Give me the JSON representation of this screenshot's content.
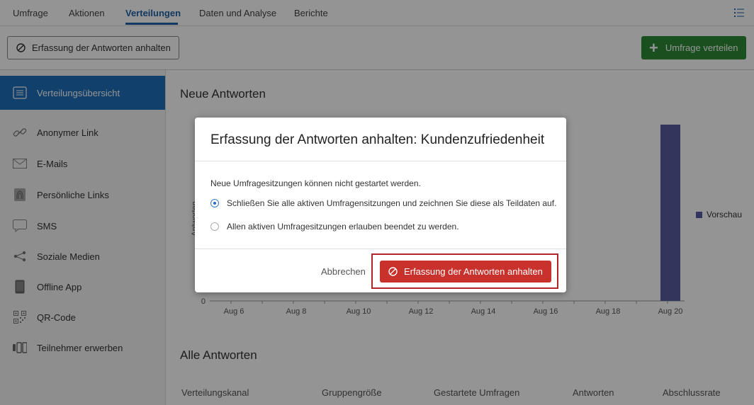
{
  "nav": {
    "tabs": [
      {
        "label": "Umfrage"
      },
      {
        "label": "Aktionen"
      },
      {
        "label": "Verteilungen"
      },
      {
        "label": "Daten und Analyse"
      },
      {
        "label": "Berichte"
      }
    ],
    "active_tab": "Verteilungen",
    "menu_icon": "list-menu-icon"
  },
  "toolbar": {
    "pause_label": "Erfassung der Antworten anhalten",
    "distribute_label": "Umfrage verteilen"
  },
  "sidebar": {
    "items": [
      {
        "label": "Verteilungsübersicht",
        "icon": "overview-icon"
      },
      {
        "label": "Anonymer Link",
        "icon": "link-icon"
      },
      {
        "label": "E-Mails",
        "icon": "envelope-icon"
      },
      {
        "label": "Persönliche Links",
        "icon": "fingerprint-icon"
      },
      {
        "label": "SMS",
        "icon": "chat-bubble-icon"
      },
      {
        "label": "Soziale Medien",
        "icon": "share-icon"
      },
      {
        "label": "Offline App",
        "icon": "tablet-icon"
      },
      {
        "label": "QR-Code",
        "icon": "qr-code-icon"
      },
      {
        "label": "Teilnehmer erwerben",
        "icon": "people-icon"
      }
    ]
  },
  "main": {
    "new_responses_title": "Neue Antworten",
    "all_responses_title": "Alle Antworten",
    "table_headers": [
      "Verteilungskanal",
      "Gruppengröße",
      "Gestartete Umfragen",
      "Antworten",
      "Abschlussrate"
    ]
  },
  "chart_data": {
    "type": "bar",
    "categories": [
      "Aug 6",
      "Aug 8",
      "Aug 10",
      "Aug 12",
      "Aug 14",
      "Aug 16",
      "Aug 18",
      "Aug 20"
    ],
    "series": [
      {
        "name": "Vorschau",
        "values": [
          0,
          0,
          0,
          0,
          0,
          0,
          0,
          1
        ]
      }
    ],
    "ylabel": "Antworten",
    "y_tick_zero": "0",
    "color": "#565d9f",
    "legend": "right"
  },
  "modal": {
    "title": "Erfassung der Antworten anhalten: Kundenzufriedenheit",
    "intro": "Neue Umfragesitzungen können nicht gestartet werden.",
    "options": [
      {
        "label": "Schließen Sie alle aktiven Umfragensitzungen und zeichnen Sie diese als Teildaten auf.",
        "selected": true
      },
      {
        "label": "Allen aktiven Umfragesitzungen erlauben beendet zu werden.",
        "selected": false
      }
    ],
    "cancel_label": "Abbrechen",
    "confirm_label": "Erfassung der Antworten anhalten"
  }
}
